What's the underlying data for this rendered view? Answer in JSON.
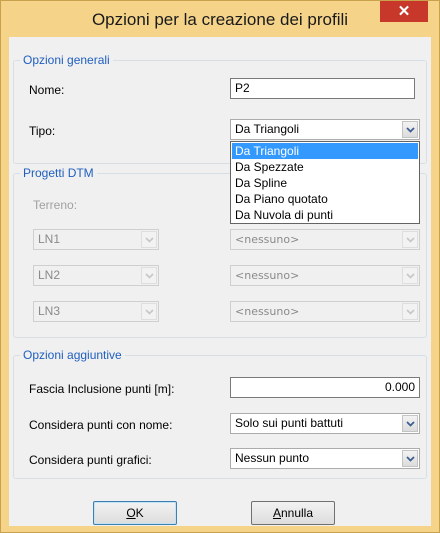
{
  "window": {
    "title": "Opzioni per la creazione dei profili",
    "close_glyph": "✕"
  },
  "general": {
    "legend": "Opzioni generali",
    "name_label": "Nome:",
    "name_value": "P2",
    "type_label": "Tipo:",
    "type_value": "Da Triangoli",
    "type_options": [
      "Da Triangoli",
      "Da Spezzate",
      "Da Spline",
      "Da Piano quotato",
      "Da Nuvola di punti"
    ],
    "type_selected_index": 0
  },
  "dtm": {
    "legend": "Progetti DTM",
    "terrain_label": "Terreno:",
    "rows": [
      {
        "layer": "LN1",
        "value": "<nessuno>"
      },
      {
        "layer": "LN2",
        "value": "<nessuno>"
      },
      {
        "layer": "LN3",
        "value": "<nessuno>"
      }
    ]
  },
  "extra": {
    "legend": "Opzioni aggiuntive",
    "band_label": "Fascia Inclusione punti [m]:",
    "band_value": "0.000",
    "named_label": "Considera punti con nome:",
    "named_value": "Solo sui punti battuti",
    "graphic_label": "Considera punti grafici:",
    "graphic_value": "Nessun punto"
  },
  "buttons": {
    "ok_underlined": "O",
    "ok_rest": "K",
    "cancel_underlined": "A",
    "cancel_rest": "nnulla"
  },
  "colors": {
    "frame": "#f5d48a",
    "close": "#c7382b",
    "legend": "#1f5fbf",
    "highlight": "#3399ff"
  },
  "icons": {
    "close": "close-icon",
    "dropdown_arrow": "chevron-down-icon"
  }
}
